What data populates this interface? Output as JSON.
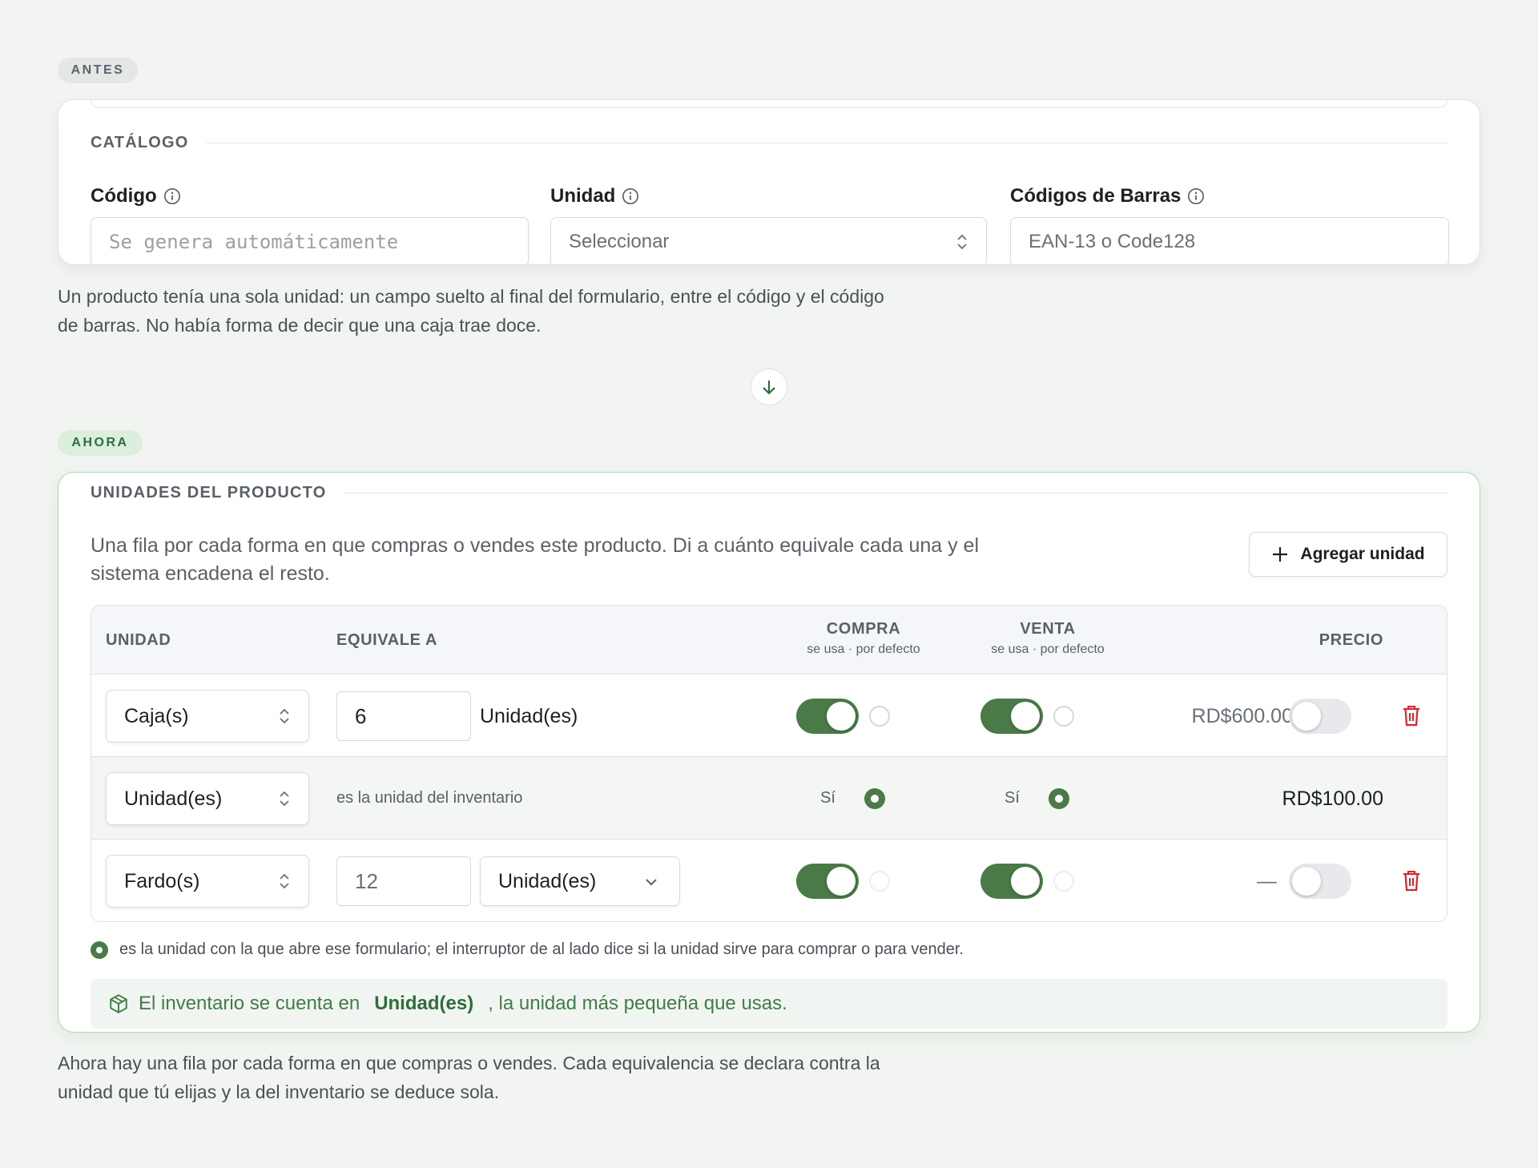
{
  "before": {
    "badge": "ANTES",
    "section_title": "CATÁLOGO",
    "fields": {
      "codigo": {
        "label": "Código",
        "placeholder": "Se genera automáticamente"
      },
      "unidad": {
        "label": "Unidad",
        "value": "Seleccionar"
      },
      "barras": {
        "label": "Códigos de Barras",
        "placeholder": "EAN-13 o Code128"
      }
    },
    "description_line1": "Un producto tenía una sola unidad: un campo suelto al final del formulario, entre el código y el código",
    "description_line2": "de barras. No había forma de decir que una caja trae doce."
  },
  "after": {
    "badge": "AHORA",
    "section_title": "UNIDADES DEL PRODUCTO",
    "intro": "Una fila por cada forma en que compras o vendes este producto. Di a cuánto equivale cada una y el sistema encadena el resto.",
    "add_button": "Agregar unidad",
    "table": {
      "headers": {
        "unidad": "UNIDAD",
        "equivale": "EQUIVALE A",
        "compra": "COMPRA",
        "compra_sub": "se usa · por defecto",
        "venta": "VENTA",
        "venta_sub": "se usa · por defecto",
        "precio": "PRECIO"
      },
      "rows": [
        {
          "unit": "Caja(s)",
          "qty": "6",
          "ref_unit": "Unidad(es)",
          "compra_on": true,
          "venta_on": true,
          "price": "RD$600.00",
          "price_toggle_on": false
        },
        {
          "unit": "Unidad(es)",
          "base_note": "es la unidad del inventario",
          "compra_label": "Sí",
          "venta_label": "Sí",
          "price": "RD$100.00"
        },
        {
          "unit": "Fardo(s)",
          "qty": "12",
          "ref_unit": "Unidad(es)",
          "compra_on": true,
          "venta_on": true,
          "price": "—",
          "price_toggle_on": false
        }
      ]
    },
    "legend": "es la unidad con la que abre ese formulario; el interruptor de al lado dice si la unidad sirve para comprar o para vender.",
    "inventory": {
      "prefix": "El inventario se cuenta en",
      "unit": "Unidad(es)",
      "suffix": ", la unidad más pequeña que usas."
    },
    "description_line1": "Ahora hay una fila por cada forma en que compras o vendes. Cada equivalencia se declara contra la",
    "description_line2": "unidad que tú elijas y la del inventario se deduce sola."
  },
  "colors": {
    "accent_green": "#4a7a48",
    "danger_red": "#d6262c"
  }
}
